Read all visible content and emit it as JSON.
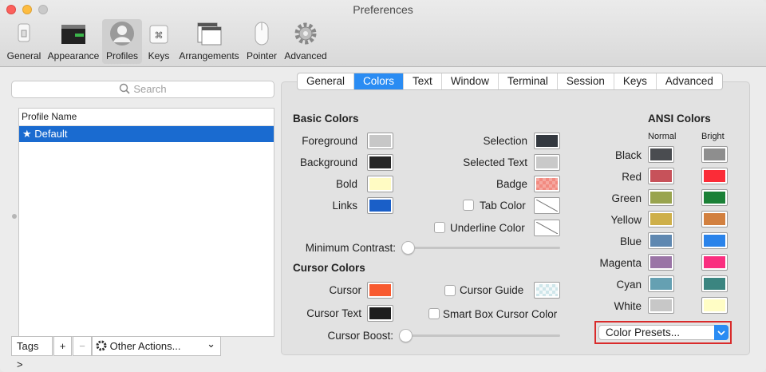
{
  "window": {
    "title": "Preferences"
  },
  "toolbar": {
    "items": [
      {
        "label": "General",
        "icon": "general-icon"
      },
      {
        "label": "Appearance",
        "icon": "appearance-icon"
      },
      {
        "label": "Profiles",
        "icon": "profiles-icon",
        "selected": true
      },
      {
        "label": "Keys",
        "icon": "keys-icon"
      },
      {
        "label": "Arrangements",
        "icon": "arrangements-icon"
      },
      {
        "label": "Pointer",
        "icon": "pointer-icon"
      },
      {
        "label": "Advanced",
        "icon": "gear-icon"
      }
    ]
  },
  "sidebar": {
    "search_placeholder": "Search",
    "column_header": "Profile Name",
    "profiles": [
      {
        "name": "★ Default",
        "selected": true
      }
    ],
    "tags_label": "Tags >",
    "add_label": "+",
    "remove_label": "−",
    "other_actions_label": "Other Actions...",
    "chevron": "⌄"
  },
  "tabs": [
    "General",
    "Colors",
    "Text",
    "Window",
    "Terminal",
    "Session",
    "Keys",
    "Advanced"
  ],
  "active_tab": "Colors",
  "basic_colors": {
    "title": "Basic Colors",
    "foreground": {
      "label": "Foreground",
      "color": "#c7c7c7"
    },
    "background": {
      "label": "Background",
      "color": "#262626"
    },
    "bold": {
      "label": "Bold",
      "color": "#fffbc3"
    },
    "links": {
      "label": "Links",
      "color": "#1a5fc8"
    },
    "selection": {
      "label": "Selection",
      "color": "#343940"
    },
    "selected_text": {
      "label": "Selected Text",
      "color": "#c9c9c9"
    },
    "badge": {
      "label": "Badge",
      "color": "#f28a80"
    },
    "tab_color": {
      "label": "Tab Color"
    },
    "underline_color": {
      "label": "Underline Color"
    },
    "minimum_contrast": {
      "label": "Minimum Contrast:",
      "value": 0
    }
  },
  "cursor_colors": {
    "title": "Cursor Colors",
    "cursor": {
      "label": "Cursor",
      "color": "#f85a2f"
    },
    "cursor_text": {
      "label": "Cursor Text",
      "color": "#1e1e1e"
    },
    "cursor_guide": {
      "label": "Cursor Guide"
    },
    "smart_box": {
      "label": "Smart Box Cursor Color"
    },
    "cursor_boost": {
      "label": "Cursor Boost:",
      "value": 0
    }
  },
  "ansi": {
    "title": "ANSI Colors",
    "normal_label": "Normal",
    "bright_label": "Bright",
    "rows": [
      {
        "name": "Black",
        "normal": "#4a4c50",
        "bright": "#8e8e8e"
      },
      {
        "name": "Red",
        "normal": "#c7525a",
        "bright": "#fb2c37"
      },
      {
        "name": "Green",
        "normal": "#99a44e",
        "bright": "#1b8137"
      },
      {
        "name": "Yellow",
        "normal": "#ceaf49",
        "bright": "#d2803f"
      },
      {
        "name": "Blue",
        "normal": "#5f88b1",
        "bright": "#2a83ea"
      },
      {
        "name": "Magenta",
        "normal": "#9a74a6",
        "bright": "#fa2e7f"
      },
      {
        "name": "Cyan",
        "normal": "#65a0b2",
        "bright": "#3b8580"
      },
      {
        "name": "White",
        "normal": "#c7c7c7",
        "bright": "#fffdc5"
      }
    ]
  },
  "color_presets": {
    "label": "Color Presets..."
  },
  "accent": "#2a8cf3",
  "highlight": "#d92b2b"
}
